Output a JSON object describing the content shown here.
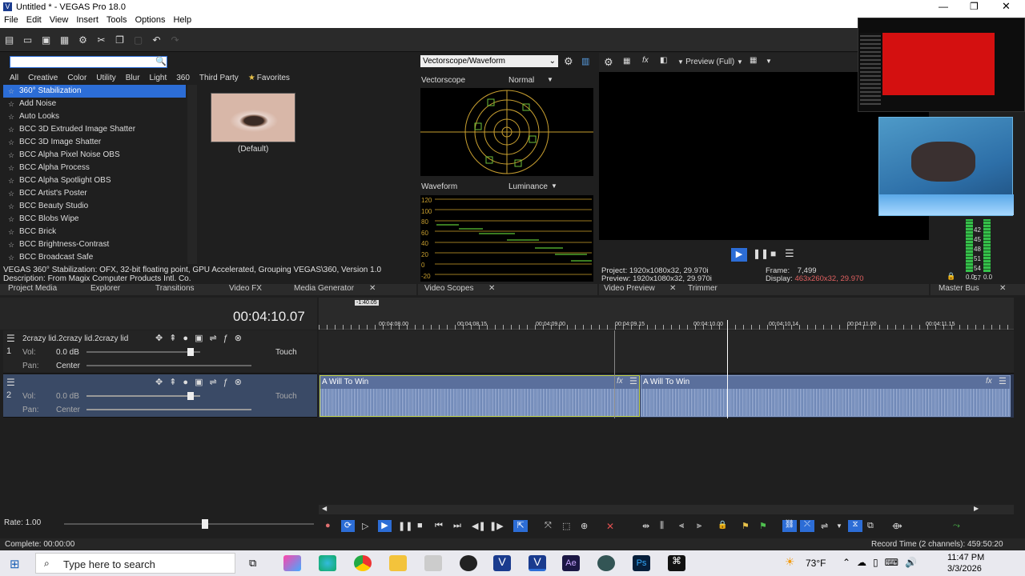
{
  "window": {
    "title": "Untitled * - VEGAS Pro 18.0"
  },
  "menu": [
    "File",
    "Edit",
    "View",
    "Insert",
    "Tools",
    "Options",
    "Help"
  ],
  "fx": {
    "categories": [
      "All",
      "Creative",
      "Color",
      "Utility",
      "Blur",
      "Light",
      "360",
      "Third Party",
      "Favorites"
    ],
    "items": [
      "360° Stabilization",
      "Add Noise",
      "Auto Looks",
      "BCC 3D Extruded Image Shatter",
      "BCC 3D Image Shatter",
      "BCC Alpha Pixel Noise OBS",
      "BCC Alpha Process",
      "BCC Alpha Spotlight OBS",
      "BCC Artist's Poster",
      "BCC Beauty Studio",
      "BCC Blobs Wipe",
      "BCC Brick",
      "BCC Brightness-Contrast",
      "BCC Broadcast Safe"
    ],
    "preset_label": "(Default)",
    "description_line1": "VEGAS 360° Stabilization: OFX, 32-bit floating point, GPU Accelerated, Grouping VEGAS\\360, Version 1.0",
    "description_line2": "Description: From Magix Computer Products Intl. Co."
  },
  "left_tabs": [
    "Project Media",
    "Explorer",
    "Transitions",
    "Video FX",
    "Media Generator"
  ],
  "scopes": {
    "selector": "Vectorscope/Waveform",
    "vectorscope_label": "Vectorscope",
    "vectorscope_mode": "Normal",
    "waveform_label": "Waveform",
    "waveform_mode": "Luminance",
    "waveform_ticks": [
      "120",
      "100",
      "80",
      "60",
      "40",
      "20",
      "0",
      "-20"
    ],
    "tab": "Video Scopes"
  },
  "preview": {
    "mode": "Preview (Full)",
    "project_label": "Project:",
    "project_value": "1920x1080x32, 29.970i",
    "preview_label": "Preview:",
    "preview_value": "1920x1080x32, 29.970i",
    "frame_label": "Frame:",
    "frame_value": "7,499",
    "display_label": "Display:",
    "display_value": "463x260x32, 29.970",
    "tabs": [
      "Video Preview",
      "Trimmer"
    ]
  },
  "master": {
    "tab": "Master Bus",
    "levels": [
      "42",
      "45",
      "48",
      "51",
      "54",
      "57"
    ],
    "readouts": [
      "0.0",
      "0.0"
    ]
  },
  "timeline": {
    "time": "00:04:10.07",
    "marker": "-1:40.05",
    "ruler": [
      "00:04:08.00",
      "00:04:08.15",
      "00:04:09.00",
      "00:04:09.15",
      "00:04:10.00",
      "00:04:10.14",
      "00:04:11.00",
      "00:04:11.15"
    ],
    "tracks": [
      {
        "num": "1",
        "name": "2crazy lid.2crazy lid.2crazy lid",
        "vol_label": "Vol:",
        "vol": "0.0 dB",
        "pan_label": "Pan:",
        "pan": "Center",
        "touch": "Touch"
      },
      {
        "num": "2",
        "name": "",
        "vol_label": "Vol:",
        "vol": "0.0 dB",
        "pan_label": "Pan:",
        "pan": "Center",
        "touch": "Touch"
      }
    ],
    "clips": [
      "A Will To Win",
      "A Will To Win"
    ]
  },
  "transport": {
    "rate": "Rate: 1.00"
  },
  "status": {
    "left": "Complete: 00:00:00",
    "right": "Record Time (2 channels): 459:50:20"
  },
  "taskbar": {
    "search": "Type here to search",
    "weather": "73°F",
    "time": "11:47 PM",
    "date": "3/3/2026"
  }
}
